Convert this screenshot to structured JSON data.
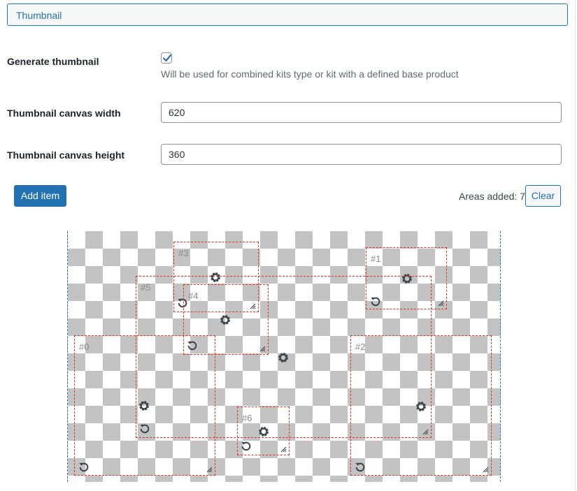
{
  "tab": {
    "label": "Thumbnail"
  },
  "generate": {
    "label": "Generate thumbnail",
    "checked": true,
    "hint": "Will be used for combined kits type or kit with a defined base product"
  },
  "width": {
    "label": "Thumbnail canvas width",
    "value": "620"
  },
  "height": {
    "label": "Thumbnail canvas height",
    "value": "360"
  },
  "actions": {
    "add_label": "Add item",
    "areas_text": "Areas added: 7",
    "clear_label": "Clear"
  },
  "areas": [
    {
      "label": "#0"
    },
    {
      "label": "#1"
    },
    {
      "label": "#2"
    },
    {
      "label": "#3"
    },
    {
      "label": "#4"
    },
    {
      "label": "#5"
    },
    {
      "label": "#6"
    }
  ],
  "icons": {
    "gear": "gear-icon",
    "rotate": "rotate-icon",
    "resize": "resize-handle-icon",
    "check": "checkmark-icon"
  },
  "colors": {
    "accent": "#2271b1",
    "area_border": "#e0301e",
    "checker": "#c3c3c3",
    "icon": "#3c434a"
  }
}
